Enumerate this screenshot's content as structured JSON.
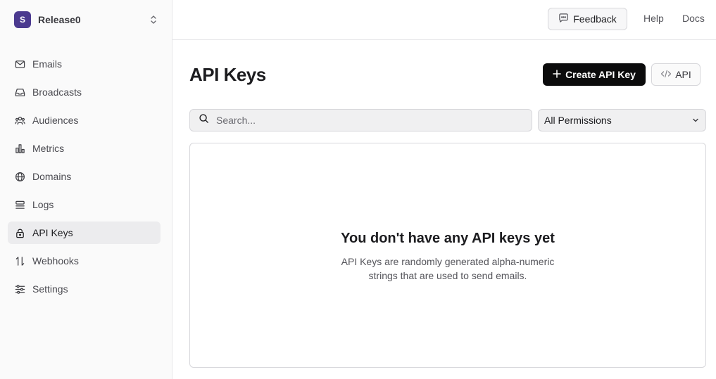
{
  "team": {
    "initial": "S",
    "name": "Release0"
  },
  "sidebar": {
    "items": [
      {
        "label": "Emails",
        "icon": "mail-icon"
      },
      {
        "label": "Broadcasts",
        "icon": "inbox-icon"
      },
      {
        "label": "Audiences",
        "icon": "users-icon"
      },
      {
        "label": "Metrics",
        "icon": "bar-chart-icon"
      },
      {
        "label": "Domains",
        "icon": "globe-icon"
      },
      {
        "label": "Logs",
        "icon": "logs-icon"
      },
      {
        "label": "API Keys",
        "icon": "lock-icon",
        "active": true
      },
      {
        "label": "Webhooks",
        "icon": "arrows-up-down-icon"
      },
      {
        "label": "Settings",
        "icon": "sliders-icon"
      }
    ]
  },
  "header": {
    "feedback": "Feedback",
    "help": "Help",
    "docs": "Docs"
  },
  "main": {
    "title": "API Keys",
    "create_button": "Create API Key",
    "api_button": "API",
    "search_placeholder": "Search...",
    "permissions_filter": "All Permissions",
    "empty_title": "You don't have any API keys yet",
    "empty_description": "API Keys are randomly generated alpha-numeric strings that are used to send emails."
  },
  "colors": {
    "accent_dark": "#0b0b0c",
    "avatar": "#4b3a8f",
    "active_bg": "#ececee"
  }
}
